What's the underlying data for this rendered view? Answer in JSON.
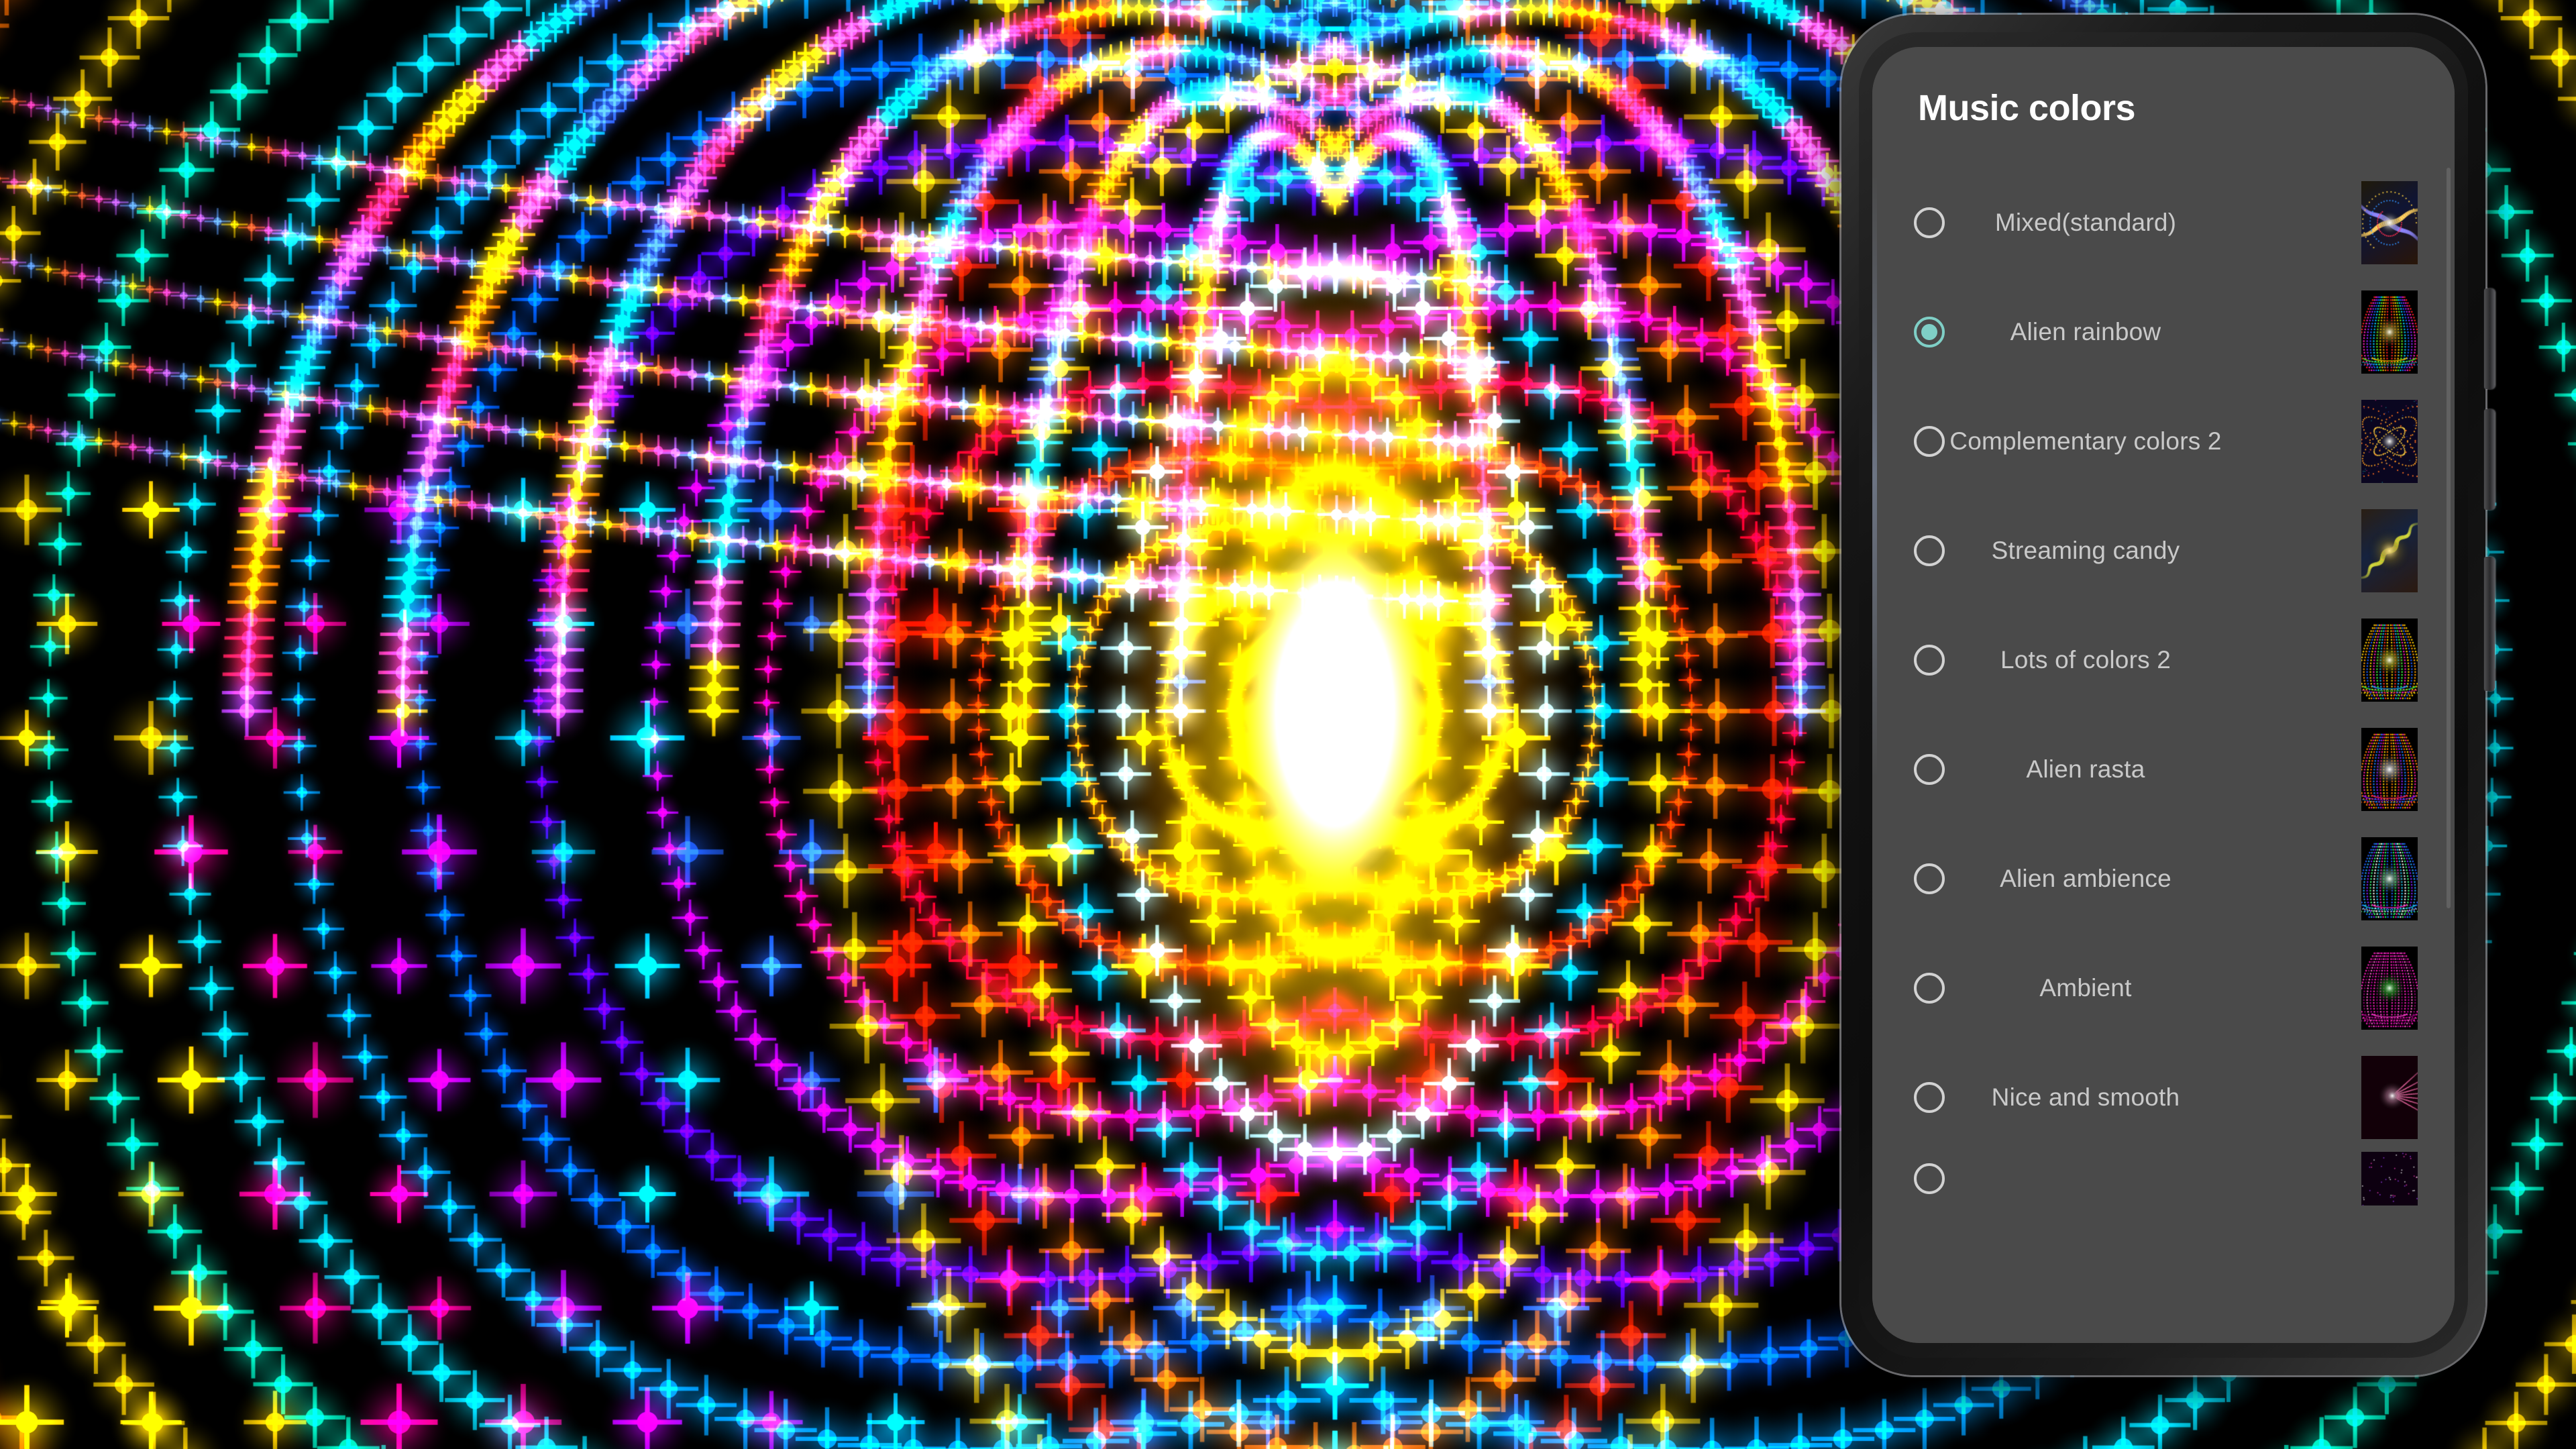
{
  "window": {
    "device": "smartphone-frame"
  },
  "dialog": {
    "title": "Music colors",
    "accent_color": "#7fcfc6",
    "background_color": "#4a4a4a",
    "label_color": "#c9c9c9",
    "title_color": "#ffffff",
    "selected_index": 1,
    "options": [
      {
        "label": "Mixed(standard)",
        "selected": false,
        "thumb": "mixed-standard-preview"
      },
      {
        "label": "Alien rainbow",
        "selected": true,
        "thumb": "alien-rainbow-preview"
      },
      {
        "label": "Complementary colors 2",
        "selected": false,
        "thumb": "complementary-colors-2-preview"
      },
      {
        "label": "Streaming candy",
        "selected": false,
        "thumb": "streaming-candy-preview"
      },
      {
        "label": "Lots of colors 2",
        "selected": false,
        "thumb": "lots-of-colors-2-preview"
      },
      {
        "label": "Alien rasta",
        "selected": false,
        "thumb": "alien-rasta-preview"
      },
      {
        "label": "Alien ambience",
        "selected": false,
        "thumb": "alien-ambience-preview"
      },
      {
        "label": "Ambient",
        "selected": false,
        "thumb": "ambient-preview"
      },
      {
        "label": "Nice and smooth",
        "selected": false,
        "thumb": "nice-and-smooth-preview"
      },
      {
        "label": "",
        "selected": false,
        "thumb": "next-preset-preview"
      }
    ]
  },
  "background": {
    "type": "music-visualizer",
    "description": "Alien rainbow particle visualization",
    "core_color": "#ffffff",
    "ring_colors": [
      "#ffd000",
      "#ffa000",
      "#ff3c00",
      "#ff0040",
      "#ff00c0",
      "#8000ff",
      "#0060ff",
      "#00c0ff",
      "#00ffd0",
      "#40ff00"
    ]
  }
}
